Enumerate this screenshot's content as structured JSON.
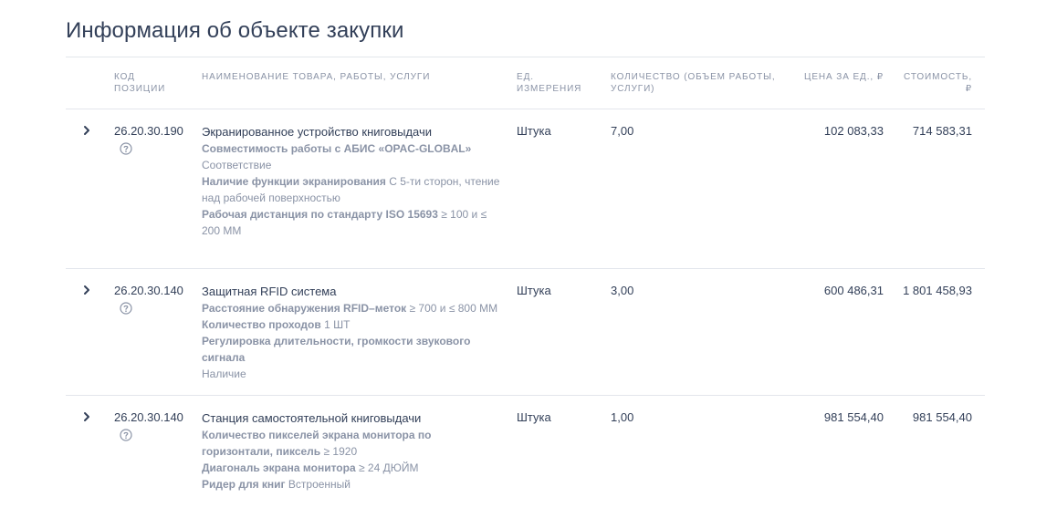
{
  "page": {
    "title": "Информация об объекте закупки"
  },
  "table": {
    "headers": {
      "code": "КОД ПОЗИЦИИ",
      "name": "НАИМЕНОВАНИЕ ТОВАРА, РАБОТЫ, УСЛУГИ",
      "unit": "ЕД. ИЗМЕРЕНИЯ",
      "qty": "КОЛИЧЕСТВО (ОБЪЕМ РАБОТЫ, УСЛУГИ)",
      "price": "ЦЕНА ЗА ЕД., ₽",
      "cost": "СТОИМОСТЬ, ₽"
    },
    "rows": [
      {
        "code": "26.20.30.190",
        "name": "Экранированное устройство книговыдачи",
        "characteristics": [
          {
            "name": "Совместимость работы с АБИС «OPAC-GLOBAL»",
            "value": "Соответствие"
          },
          {
            "name": "Наличие функции экранирования",
            "value": "С 5-ти сторон, чтение над рабочей поверхностью"
          },
          {
            "name": "Рабочая дистанция по стандарту ISO 15693",
            "value": "≥ 100 и ≤ 200 ММ"
          }
        ],
        "unit": "Штука",
        "qty": "7,00",
        "price": "102 083,33",
        "cost": "714 583,31"
      },
      {
        "code": "26.20.30.140",
        "name": "Защитная RFID система",
        "characteristics": [
          {
            "name": "Расстояние обнаружения RFID–меток",
            "value": "≥ 700 и ≤ 800 ММ"
          },
          {
            "name": "Количество проходов",
            "value": "1 ШТ"
          },
          {
            "name": "Регулировка длительности, громкости звукового сигнала",
            "value": "Наличие"
          }
        ],
        "unit": "Штука",
        "qty": "3,00",
        "price": "600 486,31",
        "cost": "1 801 458,93"
      },
      {
        "code": "26.20.30.140",
        "name": "Станция самостоятельной книговыдачи",
        "characteristics": [
          {
            "name": "Количество пикселей экрана монитора по горизонтали, пиксель",
            "value": "≥ 1920"
          },
          {
            "name": "Диагональ экрана монитора",
            "value": "≥ 24 ДЮЙМ"
          },
          {
            "name": "Ридер для книг",
            "value": "Встроенный"
          }
        ],
        "unit": "Штука",
        "qty": "1,00",
        "price": "981 554,40",
        "cost": "981 554,40"
      }
    ]
  },
  "icons": {
    "expand": "chevron-right-icon",
    "help": "question-circle-icon"
  },
  "colors": {
    "text": "#334059",
    "muted": "#8a93a6",
    "divider": "#e3e6ec"
  }
}
